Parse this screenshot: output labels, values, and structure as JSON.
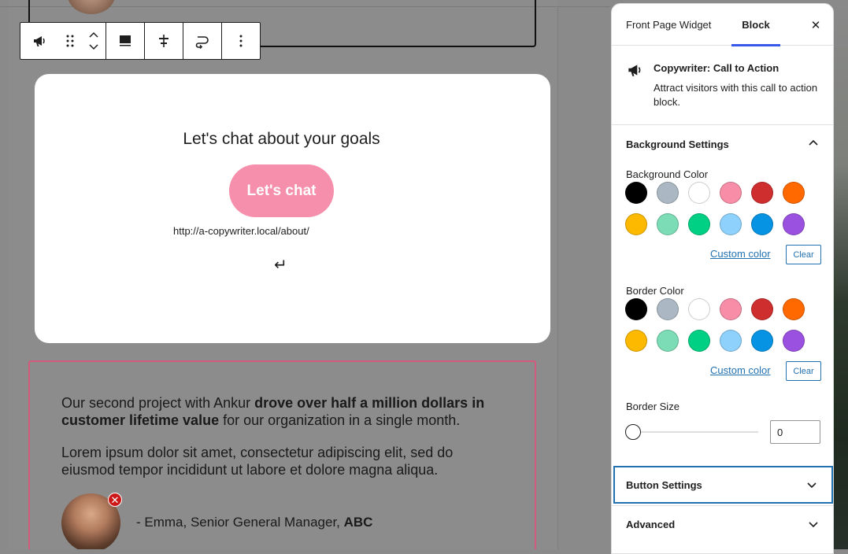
{
  "toolbar": {
    "items": [
      "block-type",
      "drag-handle",
      "move-up-down",
      "align",
      "justify",
      "link",
      "more-options"
    ]
  },
  "cta": {
    "heading": "Let's chat about your goals",
    "button_label": "Let's chat",
    "url": "http://a-copywriter.local/about/",
    "enter_glyph": "↵",
    "button_color": "#f58fab"
  },
  "testimonial": {
    "p1_a": "Our second project with Ankur ",
    "p1_bold": "drove over half a million dollars in customer lifetime value",
    "p1_b": " for our organization in a single month.",
    "p2": "Lorem ipsum dolor sit amet, consectetur adipiscing elit, sed do eiusmod tempor incididunt ut labore et dolore magna aliqua.",
    "attribution_prefix": "- Emma, Senior General Manager, ",
    "attribution_company": "ABC",
    "border_color": "#d25a7c",
    "remove_glyph": "✕"
  },
  "sidebar": {
    "tabs": [
      "Front Page Widget",
      "Block"
    ],
    "active_tab": "Block",
    "close_glyph": "✕",
    "block": {
      "title": "Copywriter: Call to Action",
      "description": "Attract visitors with this call to action block."
    },
    "background_settings": {
      "title": "Background Settings",
      "bg_color_label": "Background Color",
      "border_color_label": "Border Color",
      "custom_color": "Custom color",
      "clear": "Clear",
      "border_size_label": "Border Size",
      "border_size_value": "0",
      "palette": [
        "#000000",
        "#abb8c3",
        "#ffffff",
        "#f78da7",
        "#cf2e2e",
        "#ff6900",
        "#fcb900",
        "#7bdcb5",
        "#00d084",
        "#8ed1fc",
        "#0693e3",
        "#9b51e0"
      ]
    },
    "button_settings": "Button Settings",
    "advanced": "Advanced"
  }
}
